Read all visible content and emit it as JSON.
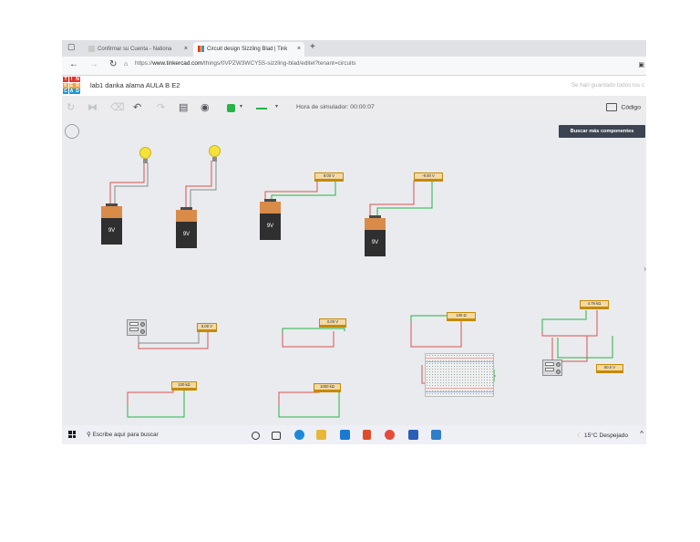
{
  "browser": {
    "tabs": [
      {
        "label": "Confirmar su Cuenta - Nationa",
        "active": false
      },
      {
        "label": "Circuit design Sizzling Blad | Tink",
        "active": true
      }
    ],
    "new_tab_glyph": "+",
    "close_glyph": "×",
    "url_prefix": "https://",
    "url_host": "www.tinkercad.com",
    "url_path": "/things/0VPZW3WCY5S-sizzling-blad/editel?tenant=circuits",
    "nav_icons": [
      "back-arrow-icon",
      "forward-arrow-icon",
      "refresh-icon",
      "lock-icon"
    ]
  },
  "app": {
    "logo_letters": [
      "T",
      "I",
      "N",
      "K",
      "E",
      "R",
      "C",
      "A",
      "D"
    ],
    "logo_colors": [
      "#e5352b",
      "#e5352b",
      "#e5352b",
      "#f2a33a",
      "#f2a33a",
      "#f2a33a",
      "#1f9ad6",
      "#1f9ad6",
      "#1f9ad6"
    ],
    "project_title": "lab1 danka alama AULA B E2",
    "saved_status": "Se han guardado todos los c"
  },
  "toolbar": {
    "simulator_time": "Hora de simulador: 00:00:07",
    "code_label": "Código",
    "color_swatch": "#25b546",
    "wire_swatch": "#25b546"
  },
  "workplane": {
    "search_button": "Buscar más componentes",
    "batteries": [
      "9V",
      "9V",
      "9V",
      "9V"
    ],
    "meter_readings": [
      "9.00 V",
      "-9.00 V",
      "5.00 V",
      "0.00 V",
      "100 Ω",
      "4.79 kΩ",
      "100 kΩ",
      "1000 kΩ",
      "3.00 kΩ",
      "50.0 V"
    ]
  },
  "taskbar": {
    "search_placeholder": "Escribe aquí para buscar",
    "weather": "15°C  Despejado",
    "chevron": "^"
  }
}
